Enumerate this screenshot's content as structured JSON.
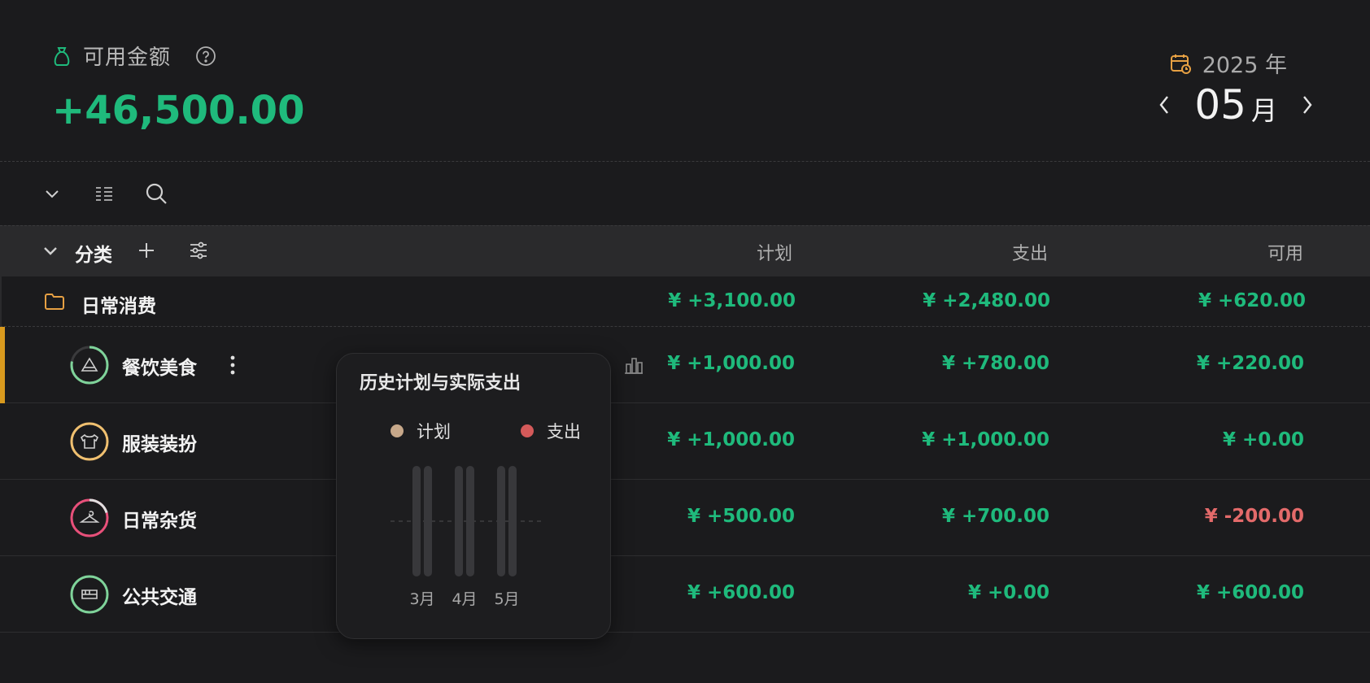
{
  "header": {
    "balance_label": "可用金额",
    "balance_amount": "+46,500.00",
    "year": "2025 年",
    "month": "05",
    "month_unit": "月"
  },
  "table": {
    "category_label": "分类",
    "columns": {
      "plan": "计划",
      "spent": "支出",
      "available": "可用"
    },
    "group": {
      "name": "日常消费",
      "plan": "¥ +3,100.00",
      "spent": "¥ +2,480.00",
      "available": "¥ +620.00"
    },
    "items": [
      {
        "name": "餐饮美食",
        "plan": "¥ +1,000.00",
        "spent": "¥ +780.00",
        "available": "¥ +220.00",
        "ring_color": "#7fd39a",
        "icon": "cake-icon"
      },
      {
        "name": "服装装扮",
        "plan": "¥ +1,000.00",
        "spent": "¥ +1,000.00",
        "available": "¥ +0.00",
        "ring_color": "#f0c070",
        "icon": "shirt-icon"
      },
      {
        "name": "日常杂货",
        "plan": "¥ +500.00",
        "spent": "¥ +700.00",
        "available": "¥ -200.00",
        "ring_color": "#e8507a",
        "icon": "hanger-icon"
      },
      {
        "name": "公共交通",
        "plan": "¥ +600.00",
        "spent": "¥ +0.00",
        "available": "¥ +600.00",
        "ring_color": "#7fd39a",
        "icon": "bus-icon"
      }
    ]
  },
  "popover": {
    "title": "历史计划与实际支出",
    "legend": [
      {
        "label": "计划",
        "color": "#c7a88a"
      },
      {
        "label": "支出",
        "color": "#d45a5a"
      }
    ],
    "months": [
      "3月",
      "4月",
      "5月"
    ]
  },
  "colors": {
    "positive": "#1fba7c",
    "negative": "#e36a6a",
    "accent_orange": "#e6a043",
    "selected_bar": "#d99a1e"
  }
}
